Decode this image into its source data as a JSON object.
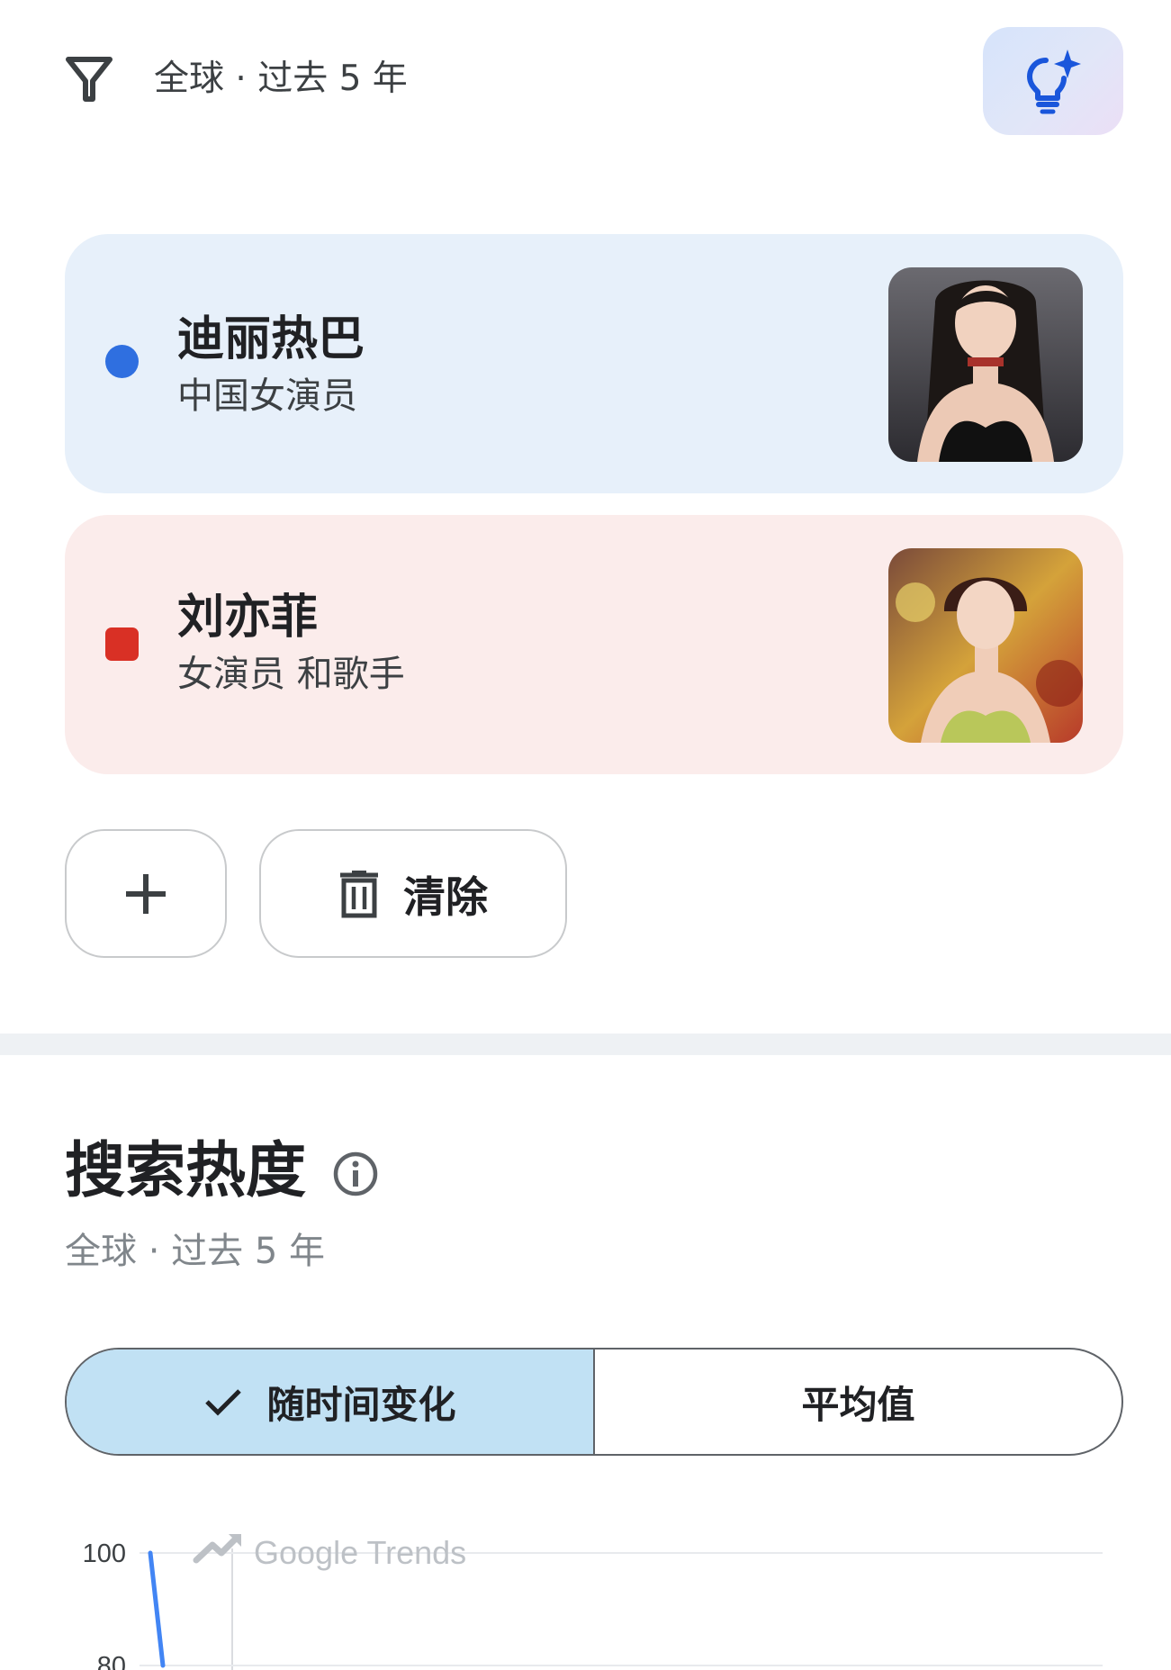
{
  "filter": {
    "label": "全球 · 过去 5 年",
    "icon": "filter-icon"
  },
  "ai_button": {
    "icon": "lightbulb-sparkle-icon"
  },
  "terms": [
    {
      "title": "迪丽热巴",
      "subtitle": "中国女演员",
      "color": "#2f6fe0",
      "marker": "circle"
    },
    {
      "title": "刘亦菲",
      "subtitle": "女演员 和歌手",
      "color": "#d93025",
      "marker": "square"
    }
  ],
  "actions": {
    "add_icon": "plus-icon",
    "clear_label": "清除",
    "clear_icon": "trash-icon"
  },
  "section": {
    "title": "搜索热度",
    "subtitle": "全球 · 过去 5 年",
    "info_icon": "info-icon"
  },
  "view_toggle": {
    "options": [
      "随时间变化",
      "平均值"
    ],
    "selected": "随时间变化"
  },
  "chart_data": {
    "type": "line",
    "watermark": "Google Trends",
    "y_ticks": [
      "100",
      "80"
    ],
    "ylim_visible": [
      80,
      100
    ],
    "series": [
      {
        "color": "#4285f4",
        "values": [
          100,
          80
        ]
      }
    ],
    "grid": true
  }
}
